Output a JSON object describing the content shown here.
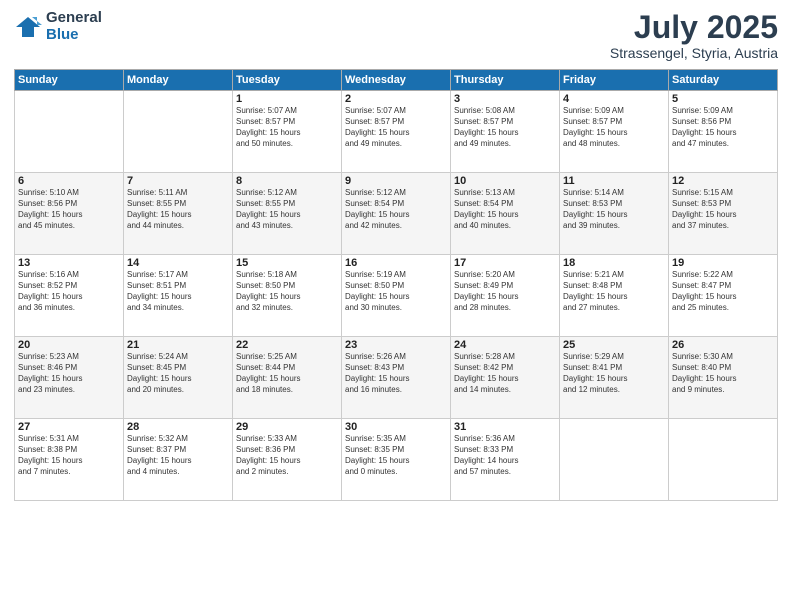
{
  "logo": {
    "general": "General",
    "blue": "Blue"
  },
  "title": {
    "month": "July 2025",
    "location": "Strassengel, Styria, Austria"
  },
  "weekdays": [
    "Sunday",
    "Monday",
    "Tuesday",
    "Wednesday",
    "Thursday",
    "Friday",
    "Saturday"
  ],
  "weeks": [
    [
      {
        "day": "",
        "info": ""
      },
      {
        "day": "",
        "info": ""
      },
      {
        "day": "1",
        "info": "Sunrise: 5:07 AM\nSunset: 8:57 PM\nDaylight: 15 hours\nand 50 minutes."
      },
      {
        "day": "2",
        "info": "Sunrise: 5:07 AM\nSunset: 8:57 PM\nDaylight: 15 hours\nand 49 minutes."
      },
      {
        "day": "3",
        "info": "Sunrise: 5:08 AM\nSunset: 8:57 PM\nDaylight: 15 hours\nand 49 minutes."
      },
      {
        "day": "4",
        "info": "Sunrise: 5:09 AM\nSunset: 8:57 PM\nDaylight: 15 hours\nand 48 minutes."
      },
      {
        "day": "5",
        "info": "Sunrise: 5:09 AM\nSunset: 8:56 PM\nDaylight: 15 hours\nand 47 minutes."
      }
    ],
    [
      {
        "day": "6",
        "info": "Sunrise: 5:10 AM\nSunset: 8:56 PM\nDaylight: 15 hours\nand 45 minutes."
      },
      {
        "day": "7",
        "info": "Sunrise: 5:11 AM\nSunset: 8:55 PM\nDaylight: 15 hours\nand 44 minutes."
      },
      {
        "day": "8",
        "info": "Sunrise: 5:12 AM\nSunset: 8:55 PM\nDaylight: 15 hours\nand 43 minutes."
      },
      {
        "day": "9",
        "info": "Sunrise: 5:12 AM\nSunset: 8:54 PM\nDaylight: 15 hours\nand 42 minutes."
      },
      {
        "day": "10",
        "info": "Sunrise: 5:13 AM\nSunset: 8:54 PM\nDaylight: 15 hours\nand 40 minutes."
      },
      {
        "day": "11",
        "info": "Sunrise: 5:14 AM\nSunset: 8:53 PM\nDaylight: 15 hours\nand 39 minutes."
      },
      {
        "day": "12",
        "info": "Sunrise: 5:15 AM\nSunset: 8:53 PM\nDaylight: 15 hours\nand 37 minutes."
      }
    ],
    [
      {
        "day": "13",
        "info": "Sunrise: 5:16 AM\nSunset: 8:52 PM\nDaylight: 15 hours\nand 36 minutes."
      },
      {
        "day": "14",
        "info": "Sunrise: 5:17 AM\nSunset: 8:51 PM\nDaylight: 15 hours\nand 34 minutes."
      },
      {
        "day": "15",
        "info": "Sunrise: 5:18 AM\nSunset: 8:50 PM\nDaylight: 15 hours\nand 32 minutes."
      },
      {
        "day": "16",
        "info": "Sunrise: 5:19 AM\nSunset: 8:50 PM\nDaylight: 15 hours\nand 30 minutes."
      },
      {
        "day": "17",
        "info": "Sunrise: 5:20 AM\nSunset: 8:49 PM\nDaylight: 15 hours\nand 28 minutes."
      },
      {
        "day": "18",
        "info": "Sunrise: 5:21 AM\nSunset: 8:48 PM\nDaylight: 15 hours\nand 27 minutes."
      },
      {
        "day": "19",
        "info": "Sunrise: 5:22 AM\nSunset: 8:47 PM\nDaylight: 15 hours\nand 25 minutes."
      }
    ],
    [
      {
        "day": "20",
        "info": "Sunrise: 5:23 AM\nSunset: 8:46 PM\nDaylight: 15 hours\nand 23 minutes."
      },
      {
        "day": "21",
        "info": "Sunrise: 5:24 AM\nSunset: 8:45 PM\nDaylight: 15 hours\nand 20 minutes."
      },
      {
        "day": "22",
        "info": "Sunrise: 5:25 AM\nSunset: 8:44 PM\nDaylight: 15 hours\nand 18 minutes."
      },
      {
        "day": "23",
        "info": "Sunrise: 5:26 AM\nSunset: 8:43 PM\nDaylight: 15 hours\nand 16 minutes."
      },
      {
        "day": "24",
        "info": "Sunrise: 5:28 AM\nSunset: 8:42 PM\nDaylight: 15 hours\nand 14 minutes."
      },
      {
        "day": "25",
        "info": "Sunrise: 5:29 AM\nSunset: 8:41 PM\nDaylight: 15 hours\nand 12 minutes."
      },
      {
        "day": "26",
        "info": "Sunrise: 5:30 AM\nSunset: 8:40 PM\nDaylight: 15 hours\nand 9 minutes."
      }
    ],
    [
      {
        "day": "27",
        "info": "Sunrise: 5:31 AM\nSunset: 8:38 PM\nDaylight: 15 hours\nand 7 minutes."
      },
      {
        "day": "28",
        "info": "Sunrise: 5:32 AM\nSunset: 8:37 PM\nDaylight: 15 hours\nand 4 minutes."
      },
      {
        "day": "29",
        "info": "Sunrise: 5:33 AM\nSunset: 8:36 PM\nDaylight: 15 hours\nand 2 minutes."
      },
      {
        "day": "30",
        "info": "Sunrise: 5:35 AM\nSunset: 8:35 PM\nDaylight: 15 hours\nand 0 minutes."
      },
      {
        "day": "31",
        "info": "Sunrise: 5:36 AM\nSunset: 8:33 PM\nDaylight: 14 hours\nand 57 minutes."
      },
      {
        "day": "",
        "info": ""
      },
      {
        "day": "",
        "info": ""
      }
    ]
  ]
}
